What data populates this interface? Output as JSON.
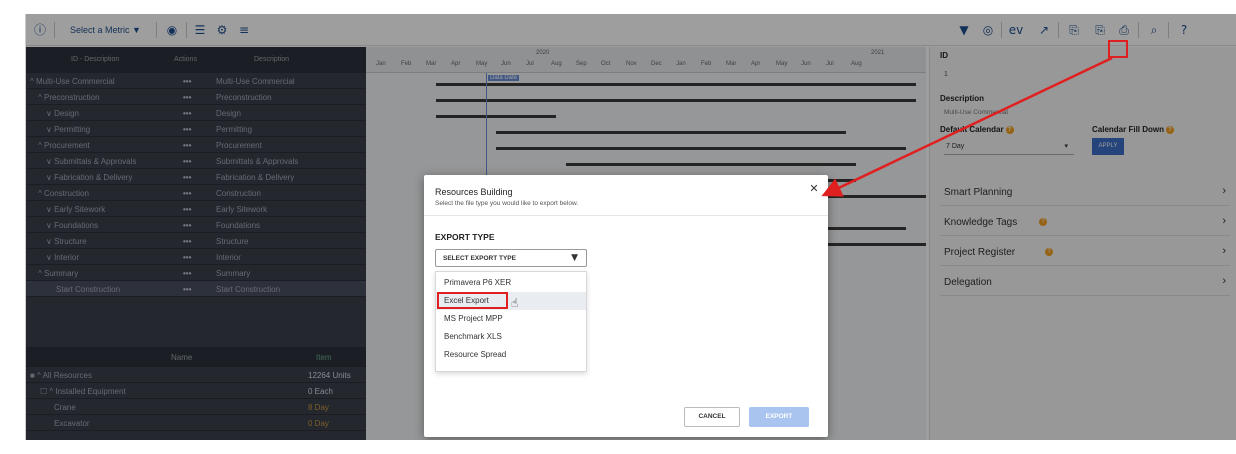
{
  "toolbar": {
    "metric_label": "Select a Metric ▼",
    "icons_left": [
      "info-icon",
      "eye-icon",
      "list-icon",
      "settings-icon",
      "sliders-icon"
    ],
    "icons_right": [
      "filter-icon",
      "globe-icon",
      "ev-icon",
      "trend-icon",
      "import-icon",
      "export-icon",
      "print-icon",
      "search-icon",
      "help-icon"
    ]
  },
  "tree": {
    "headers": {
      "id": "ID - Description",
      "actions": "Actions",
      "description": "Description"
    },
    "rows": [
      {
        "name": "^ Multi-Use Commercial",
        "actions": "•••",
        "desc": "Multi-Use Commercial"
      },
      {
        "name": "^ Preconstruction",
        "actions": "•••",
        "desc": "Preconstruction"
      },
      {
        "name": "∨ Design",
        "actions": "•••",
        "desc": "Design"
      },
      {
        "name": "∨ Permitting",
        "actions": "•••",
        "desc": "Permitting"
      },
      {
        "name": "^ Procurement",
        "actions": "•••",
        "desc": "Procurement"
      },
      {
        "name": "∨ Submittals & Approvals",
        "actions": "•••",
        "desc": "Submittals & Approvals"
      },
      {
        "name": "∨ Fabrication & Delivery",
        "actions": "•••",
        "desc": "Fabrication & Delivery"
      },
      {
        "name": "^ Construction",
        "actions": "•••",
        "desc": "Construction"
      },
      {
        "name": "∨ Early Sitework",
        "actions": "•••",
        "desc": "Early Sitework"
      },
      {
        "name": "∨ Foundations",
        "actions": "•••",
        "desc": "Foundations"
      },
      {
        "name": "∨ Structure",
        "actions": "•••",
        "desc": "Structure"
      },
      {
        "name": "∨ Interior",
        "actions": "•••",
        "desc": "Interior"
      },
      {
        "name": "^ Summary",
        "actions": "•••",
        "desc": "Summary"
      },
      {
        "name": "Start Construction",
        "actions": "•••",
        "desc": "Start Construction"
      }
    ]
  },
  "resources": {
    "header_name": "Name",
    "header_item": "Item",
    "rows": [
      {
        "name": "■ ^ All Resources",
        "value": "12264 Units"
      },
      {
        "name": "☐ ^ Installed Equipment",
        "value": "0 Each"
      },
      {
        "name": "Crane",
        "value": "8 Day"
      },
      {
        "name": "Excavator",
        "value": "0 Day"
      }
    ]
  },
  "gantt": {
    "years": [
      "2020",
      "2021"
    ],
    "months": [
      "Jan",
      "Feb",
      "Mar",
      "Apr",
      "May",
      "Jun",
      "Jul",
      "Aug",
      "Sep",
      "Oct",
      "Nov",
      "Dec",
      "Jan",
      "Feb",
      "Mar",
      "Apr",
      "May",
      "Jun",
      "Jul",
      "Aug"
    ],
    "data_date_label": "Data Date"
  },
  "right_panel": {
    "id_label": "ID",
    "id_value": "1",
    "description_label": "Description",
    "description_value": "Multi-Use Commercial",
    "default_calendar_label": "Default Calendar",
    "default_calendar_value": "7 Day",
    "calendar_fill_label": "Calendar Fill Down",
    "apply_label": "APPLY",
    "sections": [
      "Smart Planning",
      "Knowledge Tags",
      "Project Register",
      "Delegation"
    ]
  },
  "dialog": {
    "title": "Resources Building",
    "subtitle": "Select the file type you would like to export below.",
    "export_type_label": "EXPORT TYPE",
    "select_placeholder": "SELECT EXPORT TYPE",
    "options": [
      "Primavera P6 XER",
      "Excel Export",
      "MS Project MPP",
      "Benchmark XLS",
      "Resource Spread"
    ],
    "cancel_label": "CANCEL",
    "export_label": "EXPORT"
  }
}
